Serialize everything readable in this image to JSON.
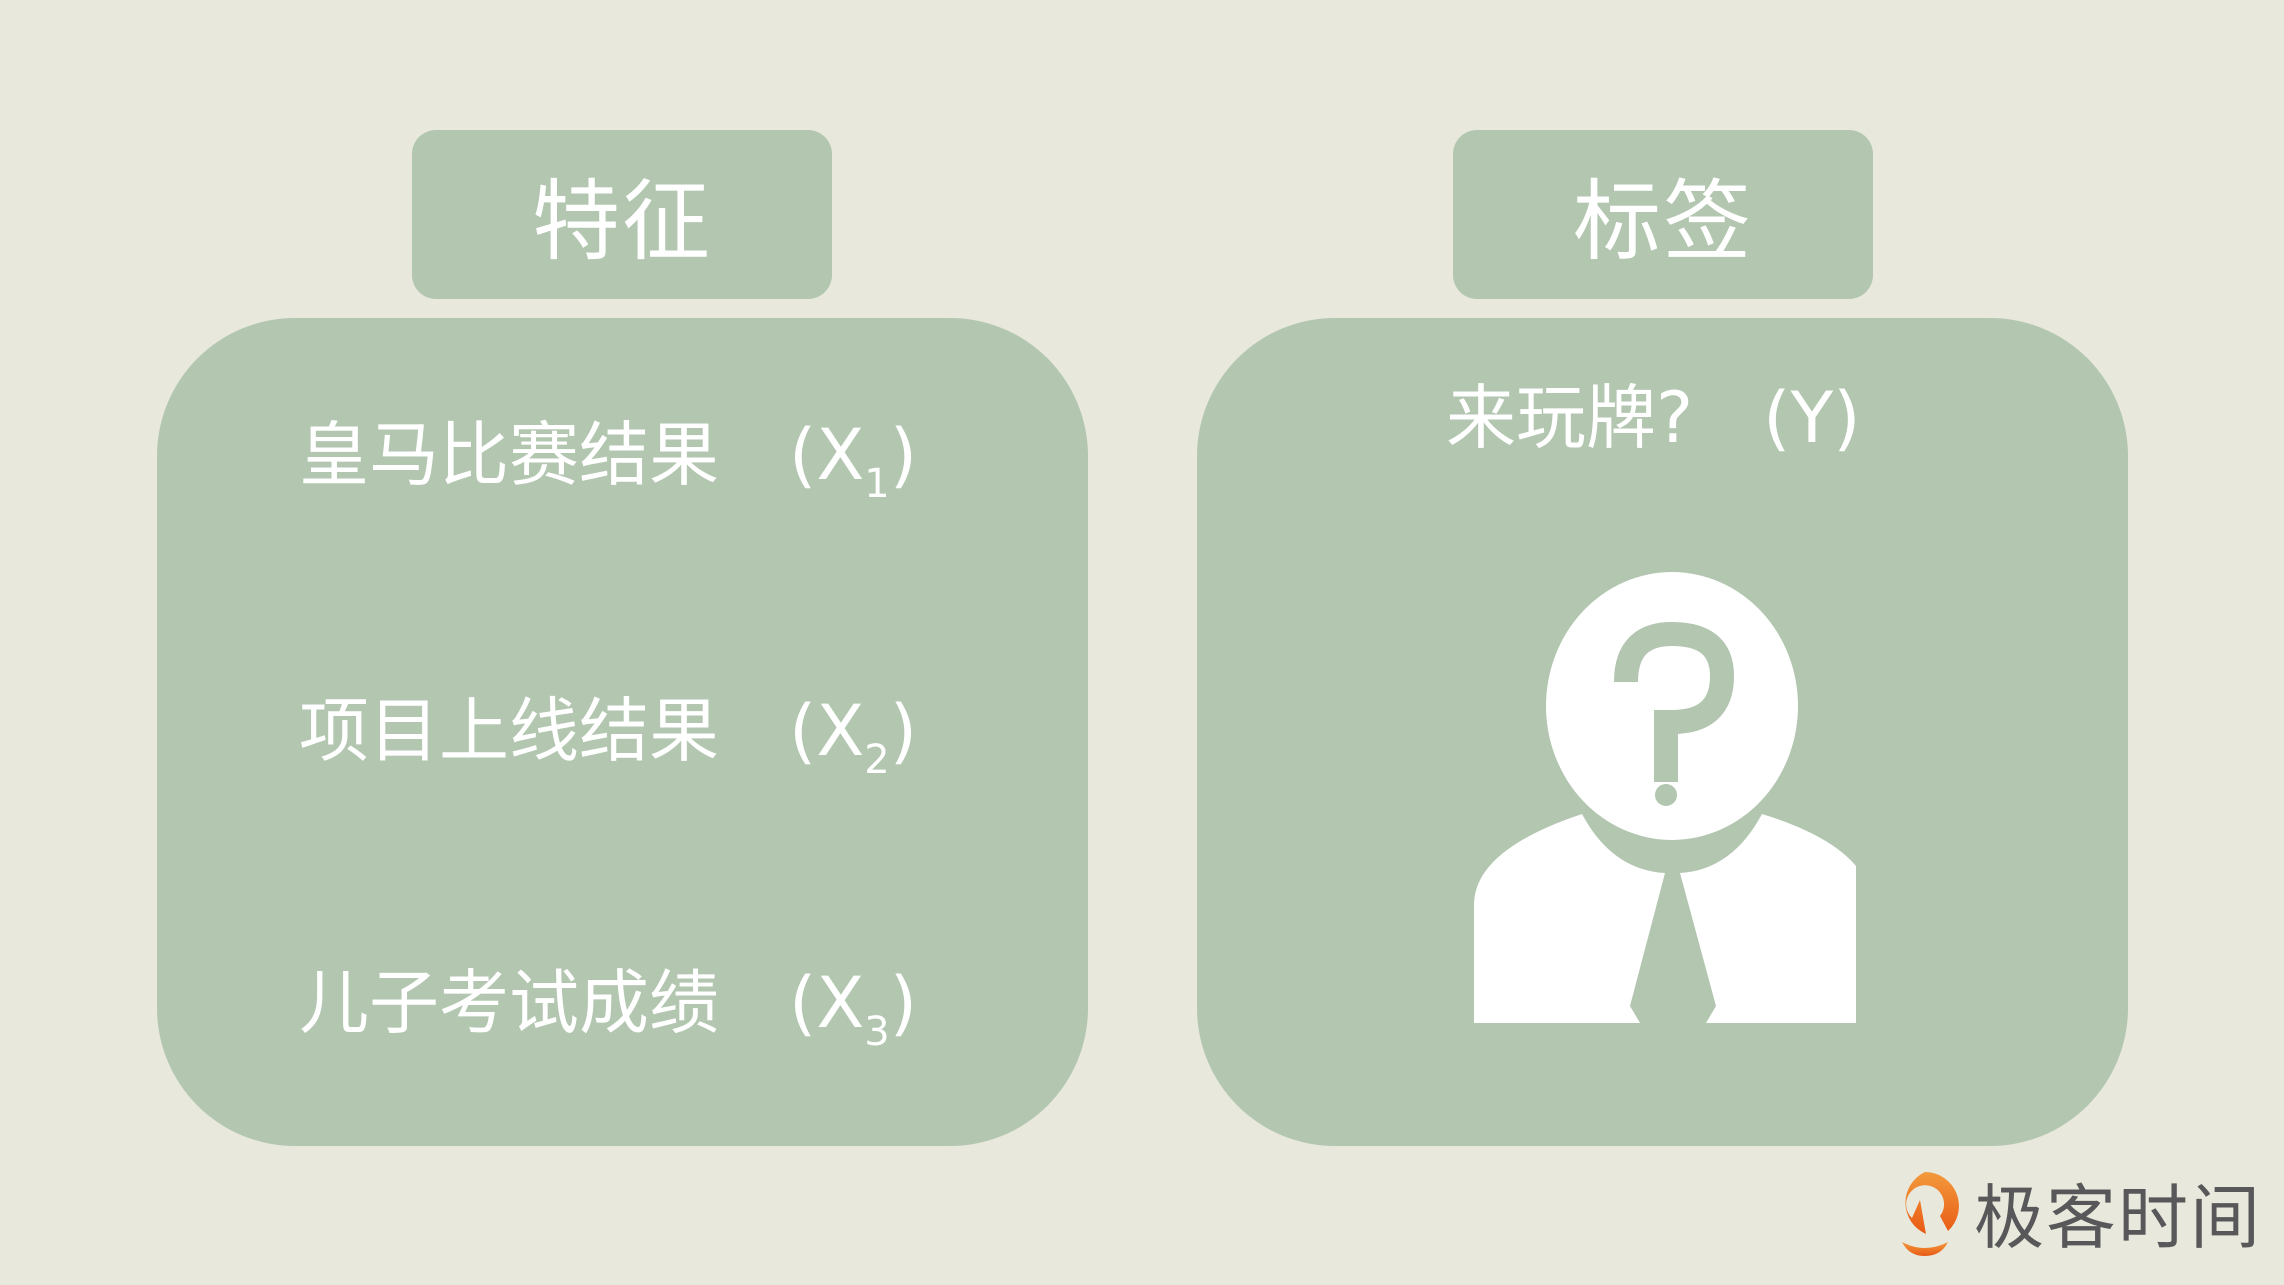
{
  "features_header": "特征",
  "label_header": "标签",
  "features": [
    {
      "text": "皇马比赛结果",
      "var": "X",
      "sub": "1"
    },
    {
      "text": "项目上线结果",
      "var": "X",
      "sub": "2"
    },
    {
      "text": "儿子考试成绩",
      "var": "X",
      "sub": "3"
    }
  ],
  "label": {
    "text": "来玩牌?",
    "var": "(Y)"
  },
  "icon": "unknown-person-icon",
  "logo": {
    "text": "极客时间",
    "color": "#ee6a1e"
  },
  "colors": {
    "background": "#e8e8dc",
    "panel": "#b2c6b0",
    "text": "#ffffff"
  }
}
